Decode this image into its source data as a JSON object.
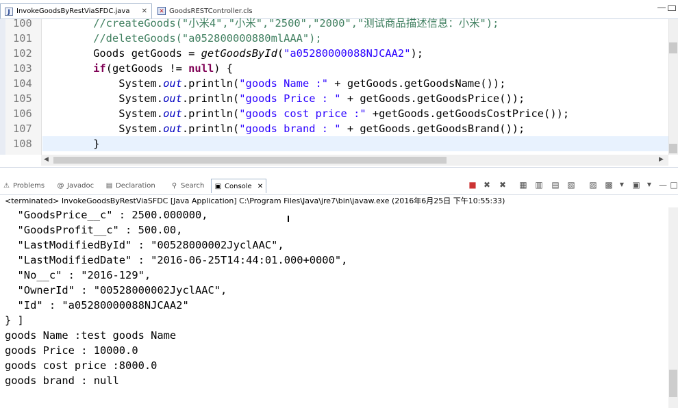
{
  "editor_tabs": [
    {
      "label": "InvokeGoodsByRestViaSFDC.java",
      "close": "✕",
      "icon": "java-file-icon"
    },
    {
      "label": "GoodsRESTController.cls",
      "icon": "apex-class-file-icon"
    }
  ],
  "code": {
    "line_numbers": [
      "100",
      "101",
      "102",
      "103",
      "104",
      "105",
      "106",
      "107",
      "108"
    ],
    "l100": {
      "t1": "        //createGoods(\"小米4\",\"小米\",\"2500\",\"2000\",\"测试商品描述信息：小米\");"
    },
    "l101": {
      "t1": "        //deleteGoods(\"a052800000880mlAAA\");"
    },
    "l102": {
      "t1": "        Goods getGoods = ",
      "t2": "getGoodsById",
      "t3": "(",
      "t4": "\"a05280000088NJCAA2\"",
      "t5": ");"
    },
    "l103": {
      "t1": "        ",
      "t2": "if",
      "t3": "(getGoods != ",
      "t4": "null",
      "t5": ") {"
    },
    "l104": {
      "t1": "            System.",
      "t2": "out",
      "t3": ".println(",
      "t4": "\"goods Name :\"",
      "t5": " + getGoods.getGoodsName());"
    },
    "l105": {
      "t1": "            System.",
      "t2": "out",
      "t3": ".println(",
      "t4": "\"goods Price : \"",
      "t5": " + getGoods.getGoodsPrice());"
    },
    "l106": {
      "t1": "            System.",
      "t2": "out",
      "t3": ".println(",
      "t4": "\"goods cost price :\"",
      "t5": " +getGoods.getGoodsCostPrice());"
    },
    "l107": {
      "t1": "            System.",
      "t2": "out",
      "t3": ".println(",
      "t4": "\"goods brand : \"",
      "t5": " + getGoods.getGoodsBrand());"
    },
    "l108": {
      "t1": "        }"
    }
  },
  "view_tabs": [
    {
      "label": "Problems",
      "icon": "problems-icon"
    },
    {
      "label": "Javadoc",
      "icon": "at-icon"
    },
    {
      "label": "Declaration",
      "icon": "declaration-icon"
    },
    {
      "label": "Search",
      "icon": "search-icon"
    },
    {
      "label": "Console",
      "icon": "console-icon",
      "close": "✕"
    }
  ],
  "console_status": "<terminated> InvokeGoodsByRestViaSFDC [Java Application] C:\\Program Files\\Java\\jre7\\bin\\javaw.exe (2016年6月25日 下午10:55:33)",
  "console_lines": [
    "  \"GoodsPrice__c\" : 2500.000000,",
    "  \"GoodsProfit__c\" : 500.00,",
    "  \"LastModifiedById\" : \"00528000002JyclAAC\",",
    "  \"LastModifiedDate\" : \"2016-06-25T14:44:01.000+0000\",",
    "  \"No__c\" : \"2016-129\",",
    "  \"OwnerId\" : \"00528000002JyclAAC\",",
    "  \"Id\" : \"a05280000088NJCAA2\"",
    "} ]",
    "goods Name :test goods Name",
    "goods Price : 10000.0",
    "goods cost price :8000.0",
    "goods brand : null"
  ],
  "colors": {
    "keyword": "#7f0055",
    "comment": "#3f7f5f",
    "string": "#2a00ff",
    "field": "#0000c0",
    "current_line": "#e8f2fe"
  }
}
